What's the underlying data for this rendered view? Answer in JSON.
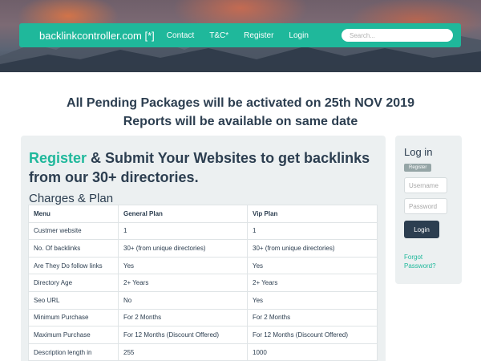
{
  "navbar": {
    "brand": "backlinkcontroller.com [*]",
    "links": [
      "Contact",
      "T&C*",
      "Register",
      "Login"
    ],
    "search_placeholder": "Search..."
  },
  "announcement": {
    "line1": "All Pending Packages will be activated on 25th NOV 2019",
    "line2": "Reports will be available on same date"
  },
  "main": {
    "headline_link": "Register",
    "headline_rest": " & Submit Your Websites to get backlinks from our 30+ directories.",
    "subhead": "Charges & Plan",
    "table": {
      "headers": [
        "Menu",
        "General Plan",
        "Vip Plan"
      ],
      "rows": [
        [
          "Custmer website",
          "1",
          "1"
        ],
        [
          "No. Of backlinks",
          "30+ (from unique directories)",
          "30+ (from unique directories)"
        ],
        [
          "Are They Do follow links",
          "Yes",
          "Yes"
        ],
        [
          "Directory Age",
          "2+ Years",
          "2+ Years"
        ],
        [
          "Seo URL",
          "No",
          "Yes"
        ],
        [
          "Minimum Purchase",
          "For 2 Months",
          "For 2 Months"
        ],
        [
          "Maximum Purchase",
          "For 12 Months (Discount Offered)",
          "For 12 Months (Discount Offered)"
        ],
        [
          "Description length in",
          "255",
          "1000"
        ]
      ]
    }
  },
  "login": {
    "title": "Log in",
    "register_badge": "Register",
    "username_placeholder": "Username",
    "password_placeholder": "Password",
    "button": "Login",
    "forgot": "Forgot Password?"
  },
  "colors": {
    "accent": "#1fb89b",
    "dark": "#2c3e50",
    "panel": "#ecf0f1"
  }
}
